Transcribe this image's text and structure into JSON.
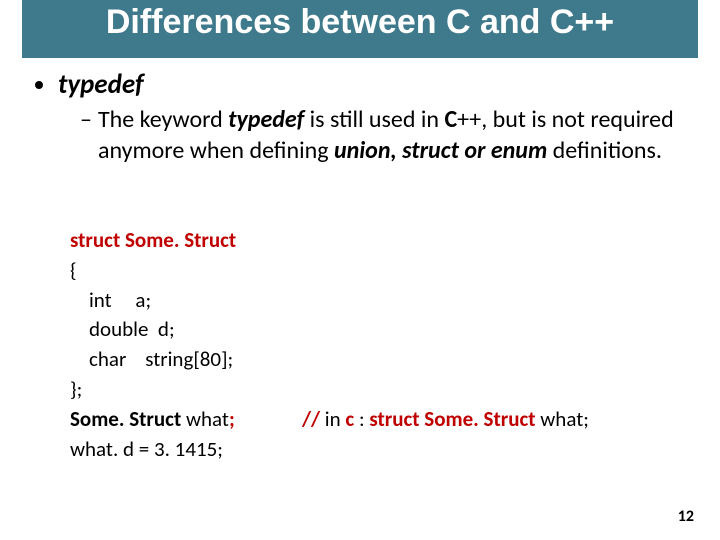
{
  "title": "Differences between C and C++",
  "bullet": {
    "label": "typedef",
    "dash_prefix": "–",
    "desc_parts": {
      "p1": "The keyword ",
      "kw1": "typedef",
      "p2": " is still used in ",
      "kw2": "C",
      "p3": "++, but is not required anymore when defining ",
      "kw3": "union, struct or enum",
      "p4": " definitions."
    }
  },
  "code": {
    "l1a": "struct",
    "l1b": " Some. Struct",
    "l2": "{",
    "l3": "    int     a;",
    "l4": "    double  d;",
    "l5": "    char    string[80];",
    "l6": "};",
    "l7a": "Some. Struct",
    "l7b": " what",
    "l7sc": ";",
    "comment_slash": "// ",
    "comment_in": "in ",
    "comment_c": "c",
    "comment_colon": " : ",
    "comment_struct": "struct Some. Struct",
    "comment_tail": " what;",
    "l8": "what. d = 3. 1415;"
  },
  "page_number": "12"
}
